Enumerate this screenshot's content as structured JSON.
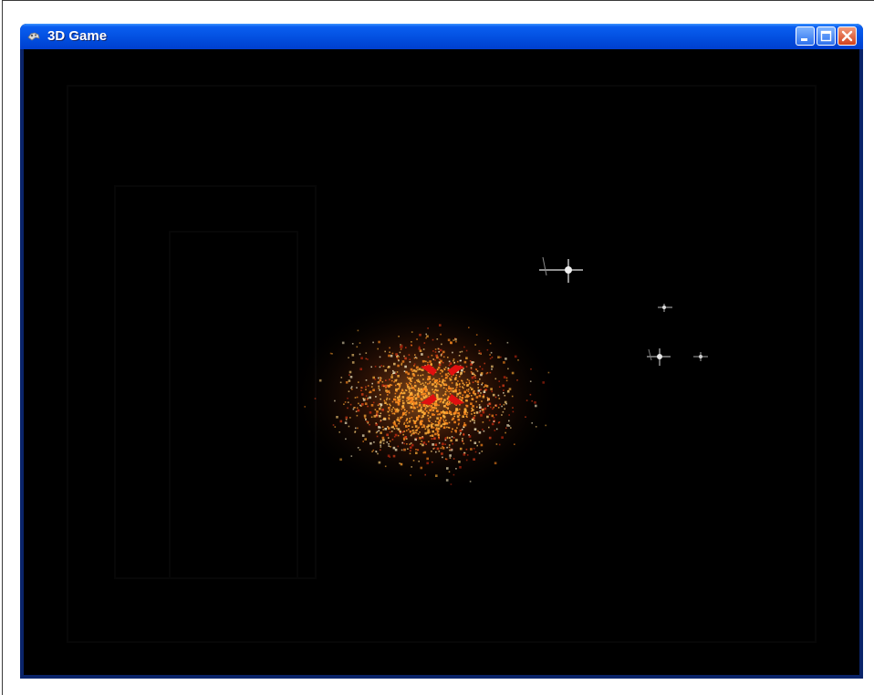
{
  "window": {
    "title": "3D Game",
    "icons": {
      "app": "game-pad-icon",
      "minimize": "minimize-icon",
      "maximize": "maximize-icon",
      "close": "close-icon"
    }
  },
  "scene": {
    "background_color": "#000000",
    "explosion_colors": [
      "#ff8a1e",
      "#ffb03a",
      "#e8421a",
      "#ffd27a",
      "#c82a10",
      "#fff2c8"
    ],
    "crosshair_color": "#e01010",
    "enemy_color": "#d9d9d9"
  }
}
